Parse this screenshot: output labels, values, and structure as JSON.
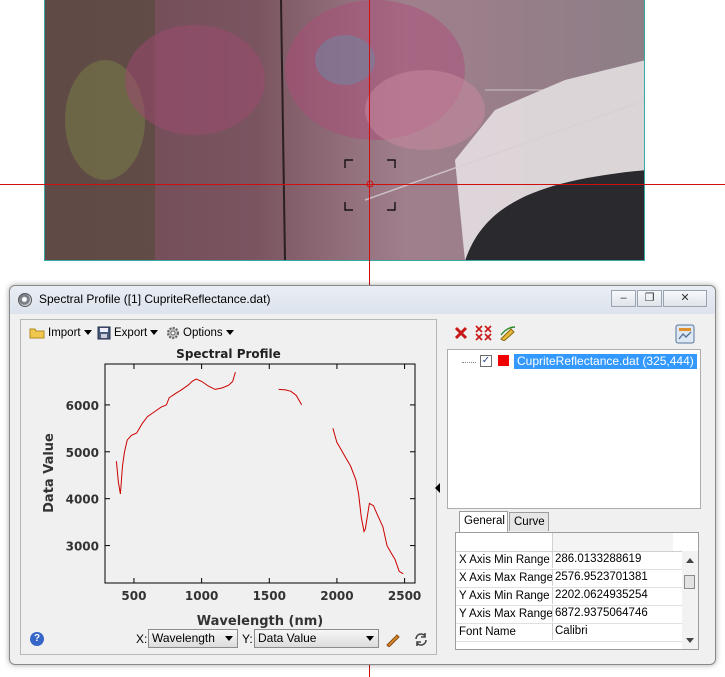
{
  "window": {
    "title": "Spectral Profile ([1] CupriteReflectance.dat)",
    "minimize_glyph": "–",
    "restore_glyph": "❐",
    "close_glyph": "✕"
  },
  "toolbar": {
    "import_label": "Import",
    "export_label": "Export",
    "options_label": "Options"
  },
  "right_toolbar": {
    "icons": [
      "delete-icon",
      "delete-all-icon",
      "edit-curve-icon",
      "chart-properties-icon"
    ]
  },
  "chart_data": {
    "type": "line",
    "title": "Spectral Profile",
    "xlabel": "Wavelength (nm)",
    "ylabel": "Data Value",
    "xlim": [
      286,
      2577
    ],
    "ylim": [
      2202,
      6872
    ],
    "xticks": [
      500,
      1000,
      1500,
      2000,
      2500
    ],
    "yticks": [
      3000,
      4000,
      5000,
      6000
    ],
    "grid": false,
    "line_color": "#cc0000",
    "series": [
      {
        "segments": [
          [
            [
              370,
              4800
            ],
            [
              385,
              4350
            ],
            [
              400,
              4100
            ],
            [
              415,
              4700
            ],
            [
              430,
              5000
            ],
            [
              450,
              5250
            ],
            [
              480,
              5350
            ],
            [
              520,
              5400
            ],
            [
              560,
              5600
            ],
            [
              600,
              5750
            ],
            [
              650,
              5850
            ],
            [
              700,
              5950
            ],
            [
              740,
              6000
            ],
            [
              760,
              6150
            ],
            [
              800,
              6230
            ],
            [
              850,
              6320
            ],
            [
              900,
              6420
            ],
            [
              930,
              6500
            ],
            [
              960,
              6550
            ],
            [
              1000,
              6500
            ],
            [
              1050,
              6400
            ],
            [
              1100,
              6330
            ],
            [
              1150,
              6360
            ],
            [
              1200,
              6420
            ],
            [
              1230,
              6500
            ],
            [
              1250,
              6700
            ]
          ],
          [
            [
              1570,
              6330
            ],
            [
              1620,
              6320
            ],
            [
              1660,
              6290
            ],
            [
              1700,
              6200
            ],
            [
              1740,
              6000
            ]
          ],
          [
            [
              1970,
              5500
            ],
            [
              1985,
              5350
            ],
            [
              2000,
              5200
            ],
            [
              2030,
              5050
            ],
            [
              2060,
              4900
            ],
            [
              2100,
              4700
            ],
            [
              2140,
              4400
            ],
            [
              2160,
              4100
            ],
            [
              2180,
              3600
            ],
            [
              2200,
              3300
            ],
            [
              2210,
              3350
            ],
            [
              2240,
              3900
            ],
            [
              2270,
              3850
            ],
            [
              2300,
              3650
            ],
            [
              2340,
              3400
            ],
            [
              2370,
              3000
            ],
            [
              2400,
              2850
            ],
            [
              2430,
              2700
            ],
            [
              2460,
              2450
            ],
            [
              2490,
              2400
            ]
          ]
        ]
      }
    ]
  },
  "axis_selectors": {
    "x_label": "X:",
    "x_value": "Wavelength",
    "y_label": "Y:",
    "y_value": "Data Value"
  },
  "tree": {
    "item_label": "CupriteReflectance.dat (325,444)",
    "checked": true,
    "check_glyph": "✓",
    "swatch_color": "#f00000"
  },
  "tabs": [
    "General",
    "Curve"
  ],
  "help_glyph": "?",
  "properties": [
    {
      "name": "X Axis Min Range",
      "value": "286.0133288619"
    },
    {
      "name": "X Axis Max Range",
      "value": "2576.9523701381"
    },
    {
      "name": "Y Axis Min Range",
      "value": "2202.0624935254"
    },
    {
      "name": "Y Axis Max Range",
      "value": "6872.9375064746"
    },
    {
      "name": "Font Name",
      "value": "Calibri"
    }
  ]
}
